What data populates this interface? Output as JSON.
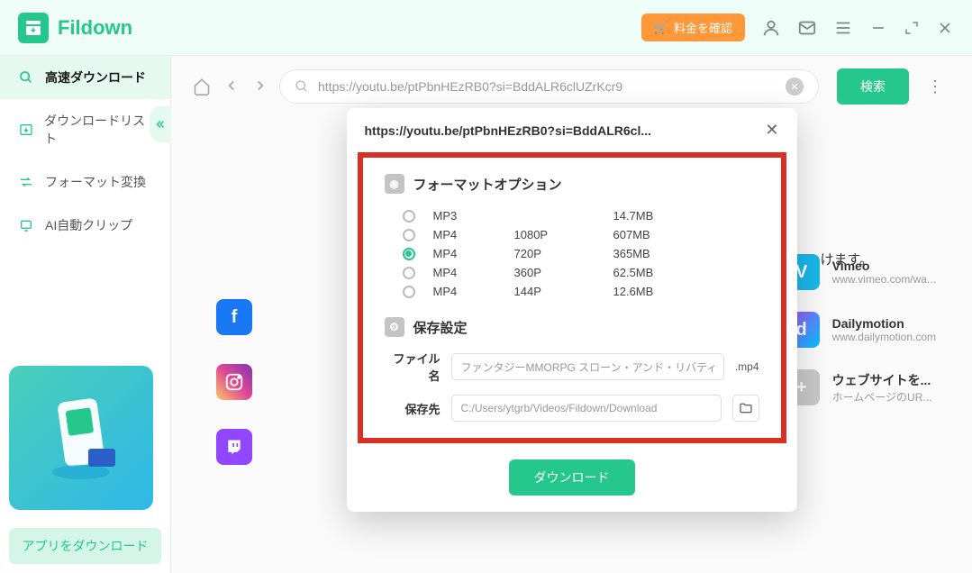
{
  "app": {
    "name": "Fildown"
  },
  "titlebar": {
    "fee_label": "料金を確認"
  },
  "sidebar": {
    "items": [
      {
        "label": "高速ダウンロード"
      },
      {
        "label": "ダウンロードリスト"
      },
      {
        "label": "フォーマット変換"
      },
      {
        "label": "AI自動クリップ"
      }
    ],
    "app_download": "アプリをダウンロード"
  },
  "search": {
    "url": "https://youtu.be/ptPbnHEzRB0?si=BddALR6clUZrKcr9",
    "button": "検索"
  },
  "hint": "！つけます。",
  "sites_left": [
    {
      "name": "Facebook",
      "letter": "f",
      "color": "#1877f2"
    },
    {
      "name": "Instagram",
      "letter": "◉",
      "color": "linear-gradient(45deg,#fdc468,#df4996,#8134af)"
    },
    {
      "name": "Twitch",
      "letter": "▮",
      "color": "#9146ff"
    }
  ],
  "sites_right": [
    {
      "name": "Vimeo",
      "url": "www.vimeo.com/wa...",
      "letter": "V",
      "color": "#1ab7ea"
    },
    {
      "name": "Dailymotion",
      "url": "www.dailymotion.com",
      "letter": "d",
      "color": "linear-gradient(135deg,#b249f8,#00c4ff)"
    },
    {
      "name": "ウェブサイトを...",
      "url": "ホームページのUR...",
      "letter": "+",
      "color": "#c8c8c8"
    }
  ],
  "modal": {
    "title": "https://youtu.be/ptPbnHEzRB0?si=BddALR6cl...",
    "format_section": "フォーマットオプション",
    "formats": [
      {
        "type": "MP3",
        "res": "",
        "size": "14.7MB",
        "selected": false
      },
      {
        "type": "MP4",
        "res": "1080P",
        "size": "607MB",
        "selected": false
      },
      {
        "type": "MP4",
        "res": "720P",
        "size": "365MB",
        "selected": true
      },
      {
        "type": "MP4",
        "res": "360P",
        "size": "62.5MB",
        "selected": false
      },
      {
        "type": "MP4",
        "res": "144P",
        "size": "12.6MB",
        "selected": false
      }
    ],
    "save_section": "保存設定",
    "filename_label": "ファイル名",
    "filename_value": "ファンタジーMMORPG スローン・アンド・リバティ 初見プ",
    "ext": ".mp4",
    "savepath_label": "保存先",
    "savepath_value": "C:/Users/ytgrb/Videos/Fildown/Download",
    "download_button": "ダウンロード"
  }
}
